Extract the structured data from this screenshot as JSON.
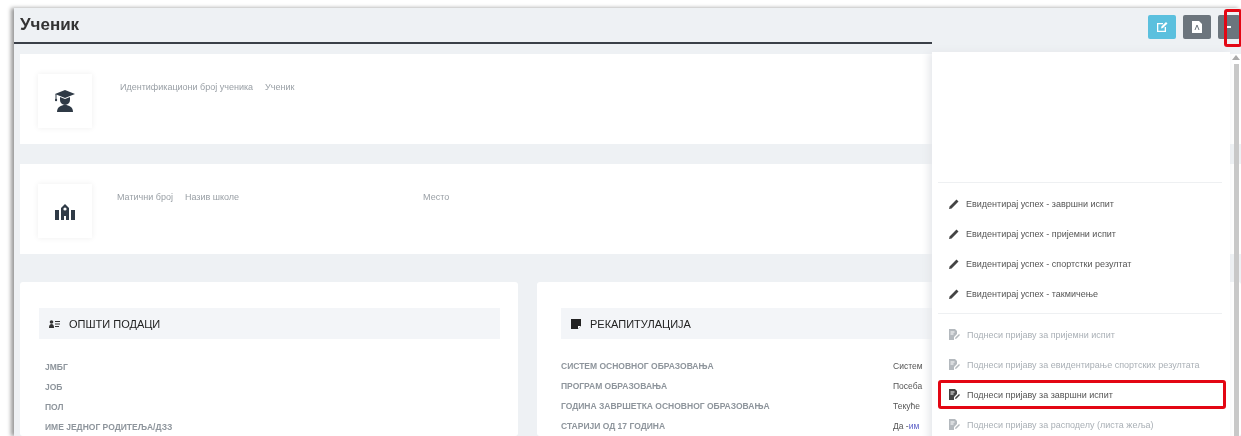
{
  "page": {
    "title": "Ученик"
  },
  "toolbar": [
    {
      "kind": "edit",
      "highlighted": false
    },
    {
      "kind": "pdf",
      "highlighted": false
    },
    {
      "kind": "more",
      "highlighted": true
    }
  ],
  "student_card": {
    "kind": "student",
    "labels": [
      "Идентификациони број ученика",
      "Ученик"
    ]
  },
  "school_card": {
    "kind": "school",
    "labels": [
      "Матични број",
      "Назив школе",
      "Место"
    ]
  },
  "general": {
    "title": "ОПШТИ ПОДАЦИ",
    "rows": [
      "ЈМБГ",
      "ЈОБ",
      "ПОЛ",
      "ИМЕ ЈЕДНОГ РОДИТЕЉА/ДЗЗ"
    ]
  },
  "summary": {
    "title": "РЕКАПИТУЛАЦИЈА",
    "rows": [
      {
        "label": "СИСТЕМ ОСНОВНОГ ОБРАЗОВАЊА",
        "value": "Систем"
      },
      {
        "label": "ПРОГРАМ ОБРАЗОВАЊА",
        "value": "Посеба"
      },
      {
        "label": "ГОДИНА ЗАВРШЕТКА ОСНОВНОГ ОБРАЗОВАЊА",
        "value": "Текуће"
      },
      {
        "label": "СТАРИЈИ ОД 17 ГОДИНА",
        "value": "Да - ",
        "link": "им"
      }
    ]
  },
  "menu": {
    "groups": [
      [
        {
          "kind": "edit",
          "label": "Евидентирај успех - завршни испит",
          "disabled": false,
          "highlighted": false
        },
        {
          "kind": "edit",
          "label": "Евидентирај успех - пријемни испит",
          "disabled": false,
          "highlighted": false
        },
        {
          "kind": "edit",
          "label": "Евидентирај успех - спортстки резултат",
          "disabled": false,
          "highlighted": false
        },
        {
          "kind": "edit",
          "label": "Евидентирај успех - такмичење",
          "disabled": false,
          "highlighted": false
        }
      ],
      [
        {
          "kind": "submit",
          "label": "Поднеси пријаву за пријемни испит",
          "disabled": true,
          "highlighted": false
        },
        {
          "kind": "submit",
          "label": "Поднеси пријаву за евидентирање спортских резултата",
          "disabled": true,
          "highlighted": false
        },
        {
          "kind": "submit",
          "label": "Поднеси пријаву за завршни испит",
          "disabled": false,
          "highlighted": true
        },
        {
          "kind": "submit",
          "label": "Поднеси пријаву за расподелу (листа жеља)",
          "disabled": true,
          "highlighted": false
        }
      ]
    ]
  }
}
